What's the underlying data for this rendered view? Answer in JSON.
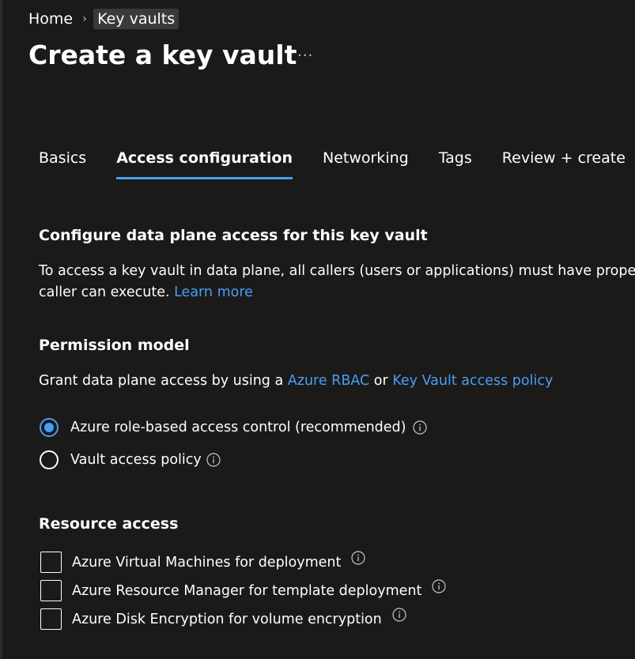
{
  "breadcrumb": {
    "home": "Home",
    "current": "Key vaults"
  },
  "page": {
    "title": "Create a key vault",
    "more": "···"
  },
  "tabs": [
    {
      "label": "Basics",
      "selected": false
    },
    {
      "label": "Access configuration",
      "selected": true
    },
    {
      "label": "Networking",
      "selected": false
    },
    {
      "label": "Tags",
      "selected": false
    },
    {
      "label": "Review + create",
      "selected": false
    }
  ],
  "data_plane": {
    "heading": "Configure data plane access for this key vault",
    "line1": "To access a key vault in data plane, all callers (users or applications) must have prope",
    "line2": "caller can execute. ",
    "learn_more": "Learn more"
  },
  "permission_model": {
    "heading": "Permission model",
    "prefix": "Grant data plane access by using a ",
    "rbac_link": "Azure RBAC",
    "or": " or ",
    "policy_link": "Key Vault access policy",
    "options": [
      {
        "label": "Azure role-based access control (recommended)",
        "checked": true
      },
      {
        "label": "Vault access policy",
        "checked": false
      }
    ]
  },
  "resource_access": {
    "heading": "Resource access",
    "options": [
      {
        "label": "Azure Virtual Machines for deployment",
        "checked": false
      },
      {
        "label": "Azure Resource Manager for template deployment",
        "checked": false
      },
      {
        "label": "Azure Disk Encryption for volume encryption",
        "checked": false
      }
    ]
  },
  "icons": {
    "info": "info-icon",
    "breadcrumb_separator": "chevron-right-icon",
    "more": "more-horizontal-icon"
  },
  "colors": {
    "background": "#1b1a19",
    "text": "#ffffff",
    "accent": "#479ef5",
    "breadcrumb_highlight": "#3b3a39"
  }
}
